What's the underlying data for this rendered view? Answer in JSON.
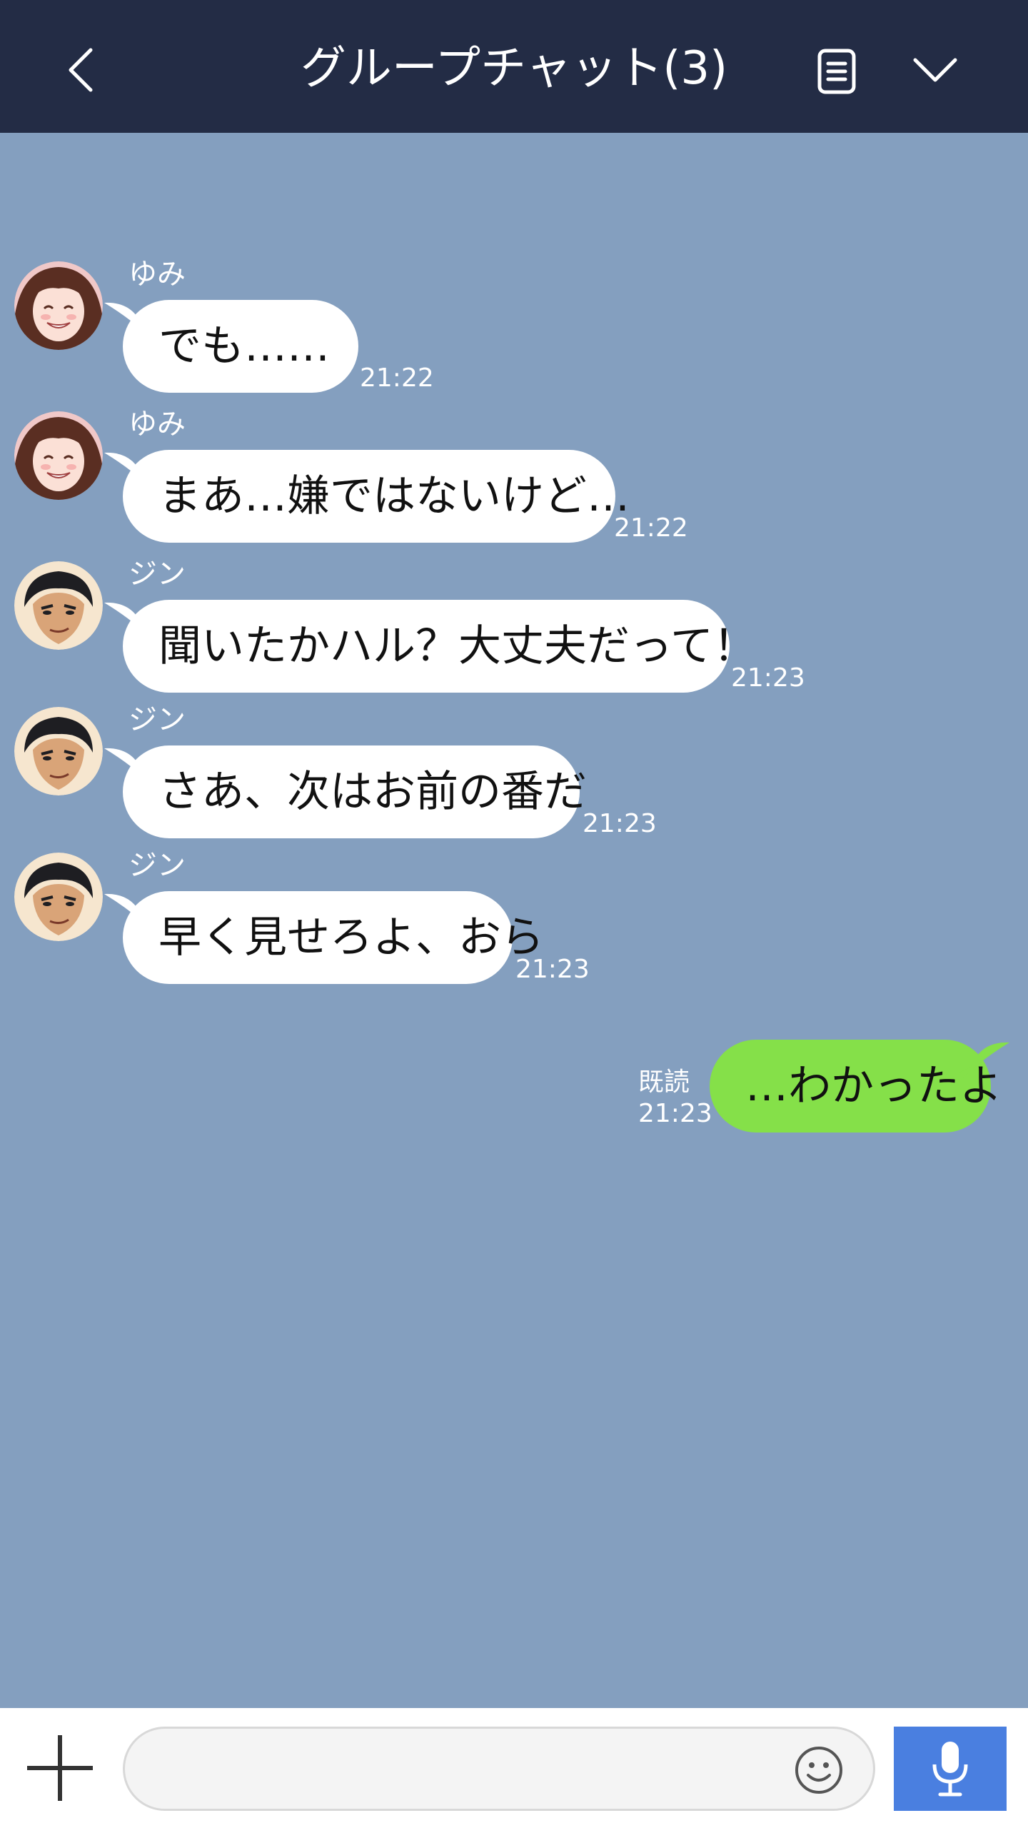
{
  "header": {
    "title": "グループチャット(3)",
    "back_icon": "chevron-left-icon",
    "notes_icon": "notes-icon",
    "menu_icon": "chevron-down-icon"
  },
  "messages": [
    {
      "sender": "ゆみ",
      "text": "でも……",
      "time": "21:22",
      "avatar": "yumi"
    },
    {
      "sender": "ゆみ",
      "text": "まあ…嫌ではないけど…",
      "time": "21:22",
      "avatar": "yumi"
    },
    {
      "sender": "ジン",
      "text": "聞いたかハル？大丈夫だって！",
      "time": "21:23",
      "avatar": "jin"
    },
    {
      "sender": "ジン",
      "text": "さあ、次はお前の番だ",
      "time": "21:23",
      "avatar": "jin"
    },
    {
      "sender": "ジン",
      "text": "早く見せろよ、おら",
      "time": "21:23",
      "avatar": "jin"
    }
  ],
  "my_message": {
    "text": "…わかったよ",
    "read_label": "既読",
    "time": "21:23"
  },
  "input": {
    "placeholder": "",
    "plus_icon": "plus-icon",
    "emoji_icon": "smiley-icon",
    "mic_icon": "microphone-icon"
  },
  "colors": {
    "header_bg": "#232c45",
    "chat_bg": "#849fbf",
    "my_bubble": "#85e049",
    "their_bubble": "#ffffff",
    "mic_button": "#4a7fe0"
  }
}
